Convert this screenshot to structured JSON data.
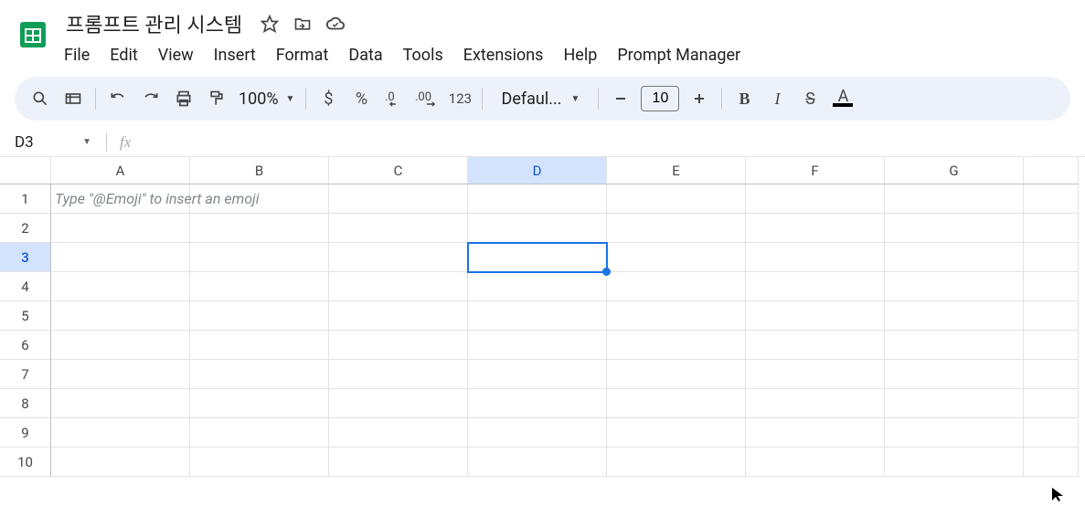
{
  "doc": {
    "title": "프롬프트 관리 시스템"
  },
  "menu": [
    "File",
    "Edit",
    "View",
    "Insert",
    "Format",
    "Data",
    "Tools",
    "Extensions",
    "Help",
    "Prompt Manager"
  ],
  "toolbar": {
    "zoom": "100%",
    "currency": "$",
    "percent": "%",
    "dec_dec": ".0",
    "dec_inc": ".00",
    "numfmt": "123",
    "font": "Defaul...",
    "fontsize": "10",
    "bold": "B",
    "italic": "I",
    "strike": "S",
    "textcolor": "A"
  },
  "namebox": "D3",
  "grid": {
    "cols": [
      "A",
      "B",
      "C",
      "D",
      "E",
      "F",
      "G"
    ],
    "rows": [
      "1",
      "2",
      "3",
      "4",
      "5",
      "6",
      "7",
      "8",
      "9",
      "10"
    ],
    "placeholder": "Type \"@Emoji\" to insert an emoji",
    "active_col": "D",
    "active_row": "3"
  }
}
